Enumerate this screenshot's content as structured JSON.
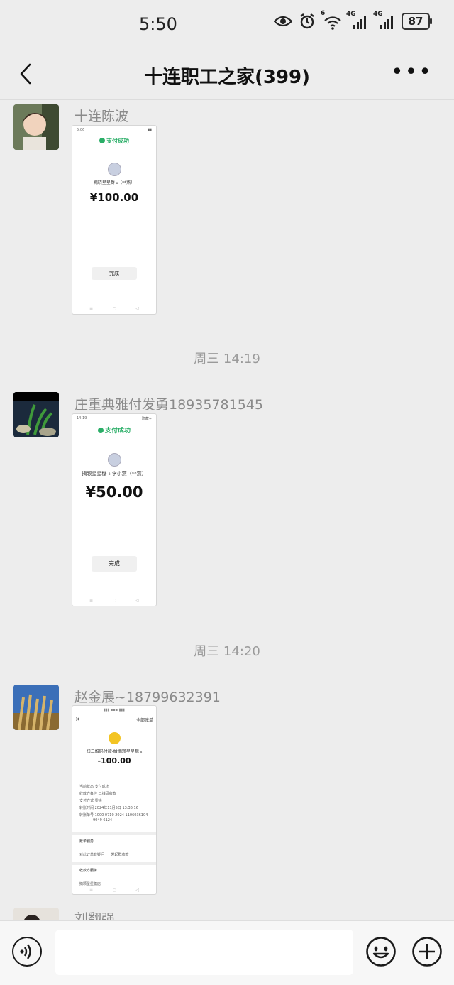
{
  "status_bar": {
    "time": "5:50",
    "battery": "87",
    "network_1": "4G",
    "network_2": "4G",
    "wifi_label": "6"
  },
  "header": {
    "title": "十连职工之家(399)"
  },
  "messages": [
    {
      "sender": "十连陈波",
      "shot": {
        "status_time": "5:06",
        "success_text": "支付成功",
        "merchant": "揭晓星星群 ₈（**燕）",
        "amount": "¥100.00",
        "button": "完成"
      }
    },
    {
      "timestamp": "周三 14:19",
      "sender": "庄重典雅付发勇18935781545",
      "shot": {
        "status_time": "14:19",
        "status_right": "隐藏+",
        "success_text": "支付成功",
        "merchant": "摘颗星星糖 ₈ 李小燕（**燕）",
        "amount": "¥50.00",
        "button": "完成"
      }
    },
    {
      "timestamp": "周三 14:20",
      "sender": "赵金展~18799632391",
      "shot": {
        "close": "×",
        "top_right": "全部账单",
        "merchant": "扫二维码付款-给摘颗星星糖 ₈",
        "amount": "-100.00",
        "details": [
          "当前状态    支付成功",
          "收款方备注  二维码收款",
          "支付方式    零钱",
          "转账时间    2024年11月5日 13:36:16",
          "转账单号    1000 0710 2024 1106036104",
          "            9049 6124"
        ],
        "section1": "账单服务",
        "actions": "对此订单有疑问      发起群收款",
        "section2": "收款方服务",
        "link": "摘颗星星糖店"
      }
    },
    {
      "sender": "刘翻强"
    }
  ]
}
